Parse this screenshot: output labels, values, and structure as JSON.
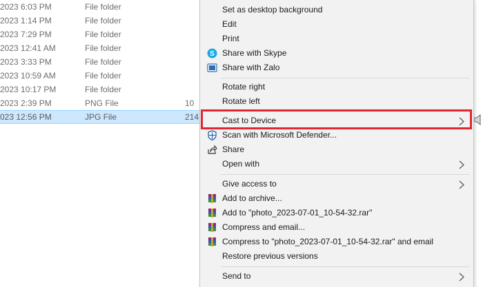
{
  "file_list": {
    "rows": [
      {
        "date": "2023 6:03 PM",
        "type": "File folder",
        "size": ""
      },
      {
        "date": "2023 1:14 PM",
        "type": "File folder",
        "size": ""
      },
      {
        "date": "2023 7:29 PM",
        "type": "File folder",
        "size": ""
      },
      {
        "date": "2023 12:41 AM",
        "type": "File folder",
        "size": ""
      },
      {
        "date": "2023 3:33 PM",
        "type": "File folder",
        "size": ""
      },
      {
        "date": "2023 10:59 AM",
        "type": "File folder",
        "size": ""
      },
      {
        "date": "2023 10:17 PM",
        "type": "File folder",
        "size": ""
      },
      {
        "date": "2023 2:39 PM",
        "type": "PNG File",
        "size": "10"
      },
      {
        "date": "023 12:56 PM",
        "type": "JPG File",
        "size": "214"
      }
    ]
  },
  "context_menu": {
    "set_desktop_bg": "Set as desktop background",
    "edit": "Edit",
    "print": "Print",
    "share_skype": "Share with Skype",
    "share_zalo": "Share with Zalo",
    "rotate_right": "Rotate right",
    "rotate_left": "Rotate left",
    "cast_to_device": "Cast to Device",
    "scan_defender": "Scan with Microsoft Defender...",
    "share": "Share",
    "open_with": "Open with",
    "give_access": "Give access to",
    "add_to_archive": "Add to archive...",
    "add_to_rar": "Add to \"photo_2023-07-01_10-54-32.rar\"",
    "compress_email": "Compress and email...",
    "compress_to_rar_email": "Compress to \"photo_2023-07-01_10-54-32.rar\" and email",
    "restore_versions": "Restore previous versions",
    "send_to": "Send to"
  },
  "colors": {
    "highlight_border": "#e0262e",
    "selected_row": "#cce8ff",
    "menu_bg": "#f2f2f2"
  },
  "icons": {
    "skype": "skype-icon",
    "zalo": "zalo-icon",
    "defender": "defender-shield-icon",
    "share": "share-icon",
    "rar": "winrar-icon",
    "speaker": "speaker-icon",
    "submenu": "chevron-right-icon"
  }
}
